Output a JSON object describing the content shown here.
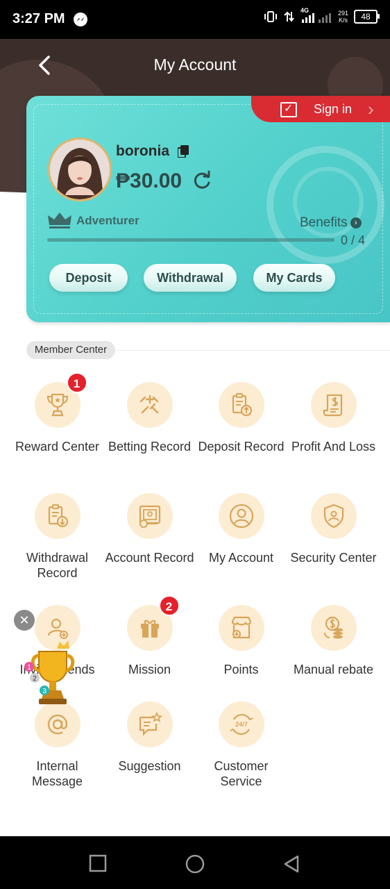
{
  "status_bar": {
    "time": "3:27 PM",
    "net_speed": "291",
    "net_unit": "K/s",
    "net_type": "4G",
    "battery": "48"
  },
  "header": {
    "title": "My Account"
  },
  "card": {
    "signin_label": "Sign in",
    "username": "boronia",
    "balance": "₱30.00",
    "level": "Adventurer",
    "benefits_label": "Benefits",
    "progress_text": "0 / 4",
    "progress_fraction": 0,
    "buttons": [
      "Deposit",
      "Withdrawal",
      "My Cards"
    ]
  },
  "member_center": {
    "title": "Member Center",
    "items": [
      {
        "label": "Reward Center",
        "icon": "trophy-icon",
        "badge": "1"
      },
      {
        "label": "Betting Record",
        "icon": "betting-icon"
      },
      {
        "label": "Deposit Record",
        "icon": "deposit-record-icon"
      },
      {
        "label": "Profit And Loss",
        "icon": "profit-loss-icon"
      },
      {
        "label": "Withdrawal Record",
        "icon": "withdrawal-record-icon"
      },
      {
        "label": "Account Record",
        "icon": "account-record-icon"
      },
      {
        "label": "My Account",
        "icon": "user-icon"
      },
      {
        "label": "Security Center",
        "icon": "shield-icon"
      },
      {
        "label": "Invite Friends",
        "icon": "invite-icon"
      },
      {
        "label": "Mission",
        "icon": "gift-icon",
        "badge": "2"
      },
      {
        "label": "Points",
        "icon": "store-icon"
      },
      {
        "label": "Manual rebate",
        "icon": "coins-icon"
      },
      {
        "label": "Internal Message",
        "icon": "at-icon"
      },
      {
        "label": "Suggestion",
        "icon": "suggestion-icon"
      },
      {
        "label": "Customer Service",
        "icon": "support-24-7-icon"
      }
    ]
  },
  "colors": {
    "accent_red": "#d92b32",
    "card_teal": "#52d0cb",
    "icon_gold": "#d8a55a",
    "icon_bg": "#fcecd2"
  }
}
